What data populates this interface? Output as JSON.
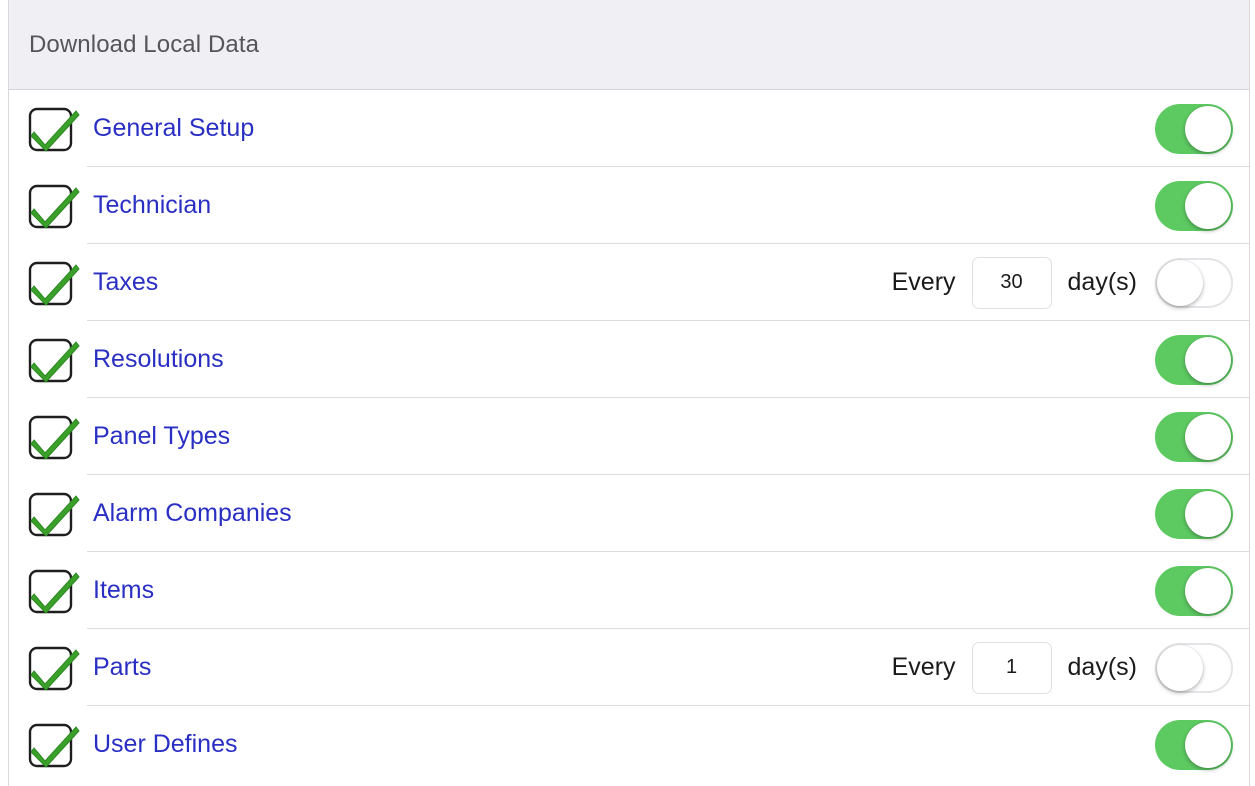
{
  "section": {
    "title": "Download Local Data"
  },
  "rows": [
    {
      "label": "General Setup",
      "checked": true,
      "enabled": true
    },
    {
      "label": "Technician",
      "checked": true,
      "enabled": true
    },
    {
      "label": "Taxes",
      "checked": true,
      "enabled": false,
      "every_label": "Every",
      "days_value": "30",
      "unit_label": "day(s)"
    },
    {
      "label": "Resolutions",
      "checked": true,
      "enabled": true
    },
    {
      "label": "Panel Types",
      "checked": true,
      "enabled": true
    },
    {
      "label": "Alarm Companies",
      "checked": true,
      "enabled": true
    },
    {
      "label": "Items",
      "checked": true,
      "enabled": true
    },
    {
      "label": "Parts",
      "checked": true,
      "enabled": false,
      "every_label": "Every",
      "days_value": "1",
      "unit_label": "day(s)"
    },
    {
      "label": "User Defines",
      "checked": true,
      "enabled": true
    }
  ],
  "icons": {
    "row_check": "checkbox-checked-icon"
  },
  "colors": {
    "label_blue": "#2a2fc4",
    "toggle_on": "#5dc961",
    "check_green": "#3aa02a",
    "header_bg": "#efeff4"
  }
}
